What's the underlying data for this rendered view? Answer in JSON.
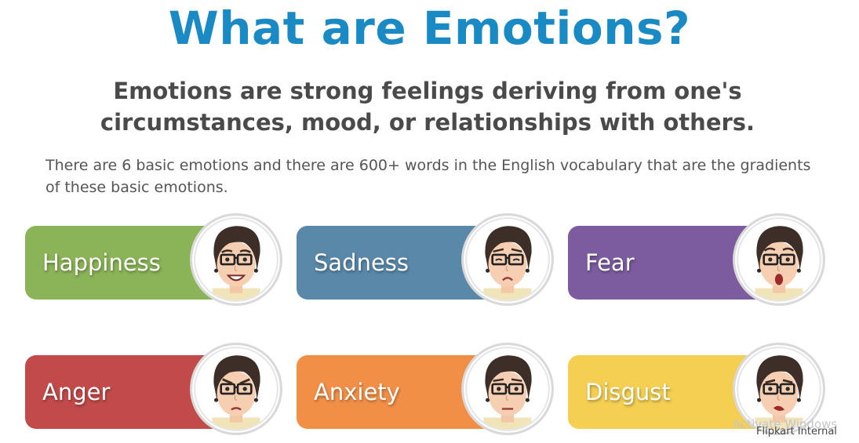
{
  "title": "What are Emotions?",
  "subtitle": "Emotions are strong feelings deriving from one's circumstances, mood, or relationships with others.",
  "body": "There are 6 basic emotions and there are 600+ words in the English vocabulary that are the gradients of these basic emotions.",
  "emotions": [
    {
      "label": "Happiness",
      "color": "#8bb357",
      "expression": "happy"
    },
    {
      "label": "Sadness",
      "color": "#5a88a9",
      "expression": "sad"
    },
    {
      "label": "Fear",
      "color": "#7c5c9f",
      "expression": "fear"
    },
    {
      "label": "Anger",
      "color": "#c24a4a",
      "expression": "angry"
    },
    {
      "label": "Anxiety",
      "color": "#f28f47",
      "expression": "anxious"
    },
    {
      "label": "Disgust",
      "color": "#f4cf52",
      "expression": "disgust"
    }
  ],
  "watermark": "Activate Windows",
  "footer_label": "Flipkart Internal"
}
